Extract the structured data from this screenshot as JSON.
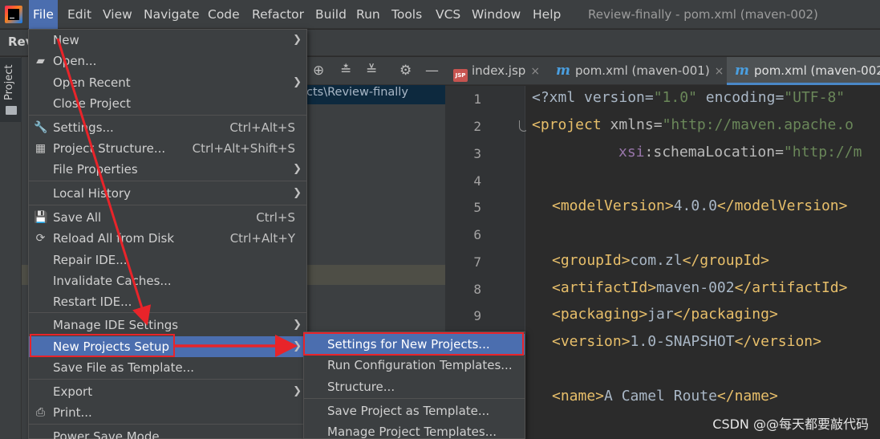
{
  "menubar": {
    "items": [
      {
        "label": "File"
      },
      {
        "label": "Edit"
      },
      {
        "label": "View"
      },
      {
        "label": "Navigate"
      },
      {
        "label": "Code"
      },
      {
        "label": "Refactor"
      },
      {
        "label": "Build"
      },
      {
        "label": "Run"
      },
      {
        "label": "Tools"
      },
      {
        "label": "VCS"
      },
      {
        "label": "Window"
      },
      {
        "label": "Help"
      }
    ],
    "window_title": "Review-finally - pom.xml (maven-002)"
  },
  "navbar": {
    "project_name": "Rev"
  },
  "left_stripe": {
    "project_tab": "Project"
  },
  "project_panel": {
    "path_fragment": "cts\\Review-finally"
  },
  "tabs": [
    {
      "label": "index.jsp",
      "icon": "jsp-file-icon"
    },
    {
      "label": "pom.xml (maven-001)",
      "icon": "maven-icon"
    },
    {
      "label": "pom.xml (maven-002",
      "icon": "maven-icon"
    }
  ],
  "tab_icon_text": {
    "jsp": "JSP",
    "maven": "m"
  },
  "editor": {
    "line_numbers": [
      "1",
      "2",
      "3",
      "4",
      "5",
      "6",
      "7",
      "8",
      "9"
    ],
    "lines": {
      "l1": {
        "p1": "<?xml version=",
        "p2": "\"1.0\"",
        "p3": " encoding=",
        "p4": "\"UTF-8\""
      },
      "l2": {
        "p1": "<project ",
        "p2": "xmlns=",
        "p3": "\"http://maven.apache.o"
      },
      "l3": {
        "p1": "xsi",
        "p2": ":schemaLocation=",
        "p3": "\"http://m"
      },
      "l5": {
        "p1": "<modelVersion>",
        "p2": "4.0.0",
        "p3": "</modelVersion>"
      },
      "l7": {
        "p1": "<groupId>",
        "p2": "com.zl",
        "p3": "</groupId>"
      },
      "l8": {
        "p1": "<artifactId>",
        "p2": "maven-002",
        "p3": "</artifactId>"
      },
      "l9": {
        "p1": "<packaging>",
        "p2": "jar",
        "p3": "</packaging>"
      },
      "l10": {
        "p1": "<version>",
        "p2": "1.0-SNAPSHOT",
        "p3": "</version>"
      },
      "l12": {
        "p1": "<name>",
        "p2": "A Camel Route",
        "p3": "</name>"
      }
    }
  },
  "file_menu": {
    "new": "New",
    "open": "Open...",
    "open_recent": "Open Recent",
    "close_project": "Close Project",
    "settings": "Settings...",
    "settings_sc": "Ctrl+Alt+S",
    "project_structure": "Project Structure...",
    "project_structure_sc": "Ctrl+Alt+Shift+S",
    "file_properties": "File Properties",
    "local_history": "Local History",
    "save_all": "Save All",
    "save_all_sc": "Ctrl+S",
    "reload": "Reload All from Disk",
    "reload_sc": "Ctrl+Alt+Y",
    "repair": "Repair IDE...",
    "invalidate": "Invalidate Caches...",
    "restart": "Restart IDE...",
    "manage_settings": "Manage IDE Settings",
    "new_projects_setup": "New Projects Setup",
    "save_as_template": "Save File as Template...",
    "export": "Export",
    "print": "Print...",
    "power_save": "Power Save Mode"
  },
  "sub_menu": {
    "items": [
      {
        "label": "Settings for New Projects..."
      },
      {
        "label": "Run Configuration Templates..."
      },
      {
        "label": "Structure..."
      },
      {
        "label": "Save Project as Template..."
      },
      {
        "label": "Manage Project Templates..."
      }
    ]
  },
  "watermark": "CSDN @@每天都要敲代码",
  "colors": {
    "menu_bg": "#3c3f41",
    "selection": "#4b6eaf",
    "annotation_red": "#e8242a"
  }
}
